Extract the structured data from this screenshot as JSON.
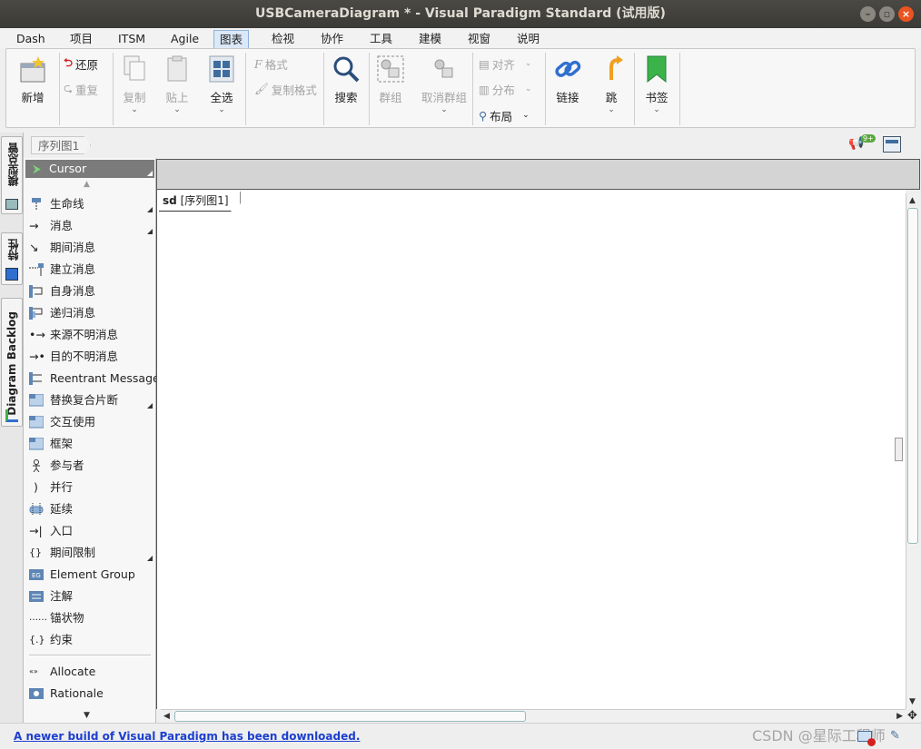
{
  "window": {
    "title": "USBCameraDiagram * - Visual Paradigm Standard (试用版)"
  },
  "menu": [
    "Dash",
    "项目",
    "ITSM",
    "Agile",
    "图表",
    "检视",
    "协作",
    "工具",
    "建模",
    "视窗",
    "说明"
  ],
  "menu_active": "图表",
  "ribbon": {
    "new": "新增",
    "undo": "还原",
    "redo": "重复",
    "copy": "复制",
    "paste": "贴上",
    "select_all": "全选",
    "format": "格式",
    "copy_format": "复制格式",
    "search": "搜索",
    "group": "群组",
    "ungroup": "取消群组",
    "align": "对齐",
    "distribute": "分布",
    "layout": "布局",
    "link": "链接",
    "jump": "跳",
    "bookmark": "书签"
  },
  "breadcrumb": "序列图1",
  "notification_badge": "9+",
  "side_tabs": [
    "模型总管",
    "特性",
    "Diagram Backlog"
  ],
  "palette": {
    "cursor": "Cursor",
    "items": [
      "生命线",
      "消息",
      "期间消息",
      "建立消息",
      "自身消息",
      "递归消息",
      "来源不明消息",
      "目的不明消息",
      "Reentrant Message",
      "替换复合片断",
      "交互使用",
      "框架",
      "参与者",
      "并行",
      "延续",
      "入口",
      "期间限制",
      "Element Group",
      "注解",
      "锚状物",
      "约束"
    ],
    "items2": [
      "Allocate",
      "Rationale"
    ]
  },
  "frame": {
    "kind": "sd",
    "name": "[序列图1]"
  },
  "status": {
    "message": "A newer build of Visual Paradigm has been downloaded.",
    "watermark": "CSDN @星际工程师"
  },
  "colors": {
    "accent": "#dbe8f7",
    "link": "#1c3fcf",
    "title_bg": "#3b3a36",
    "close": "#e95420"
  }
}
